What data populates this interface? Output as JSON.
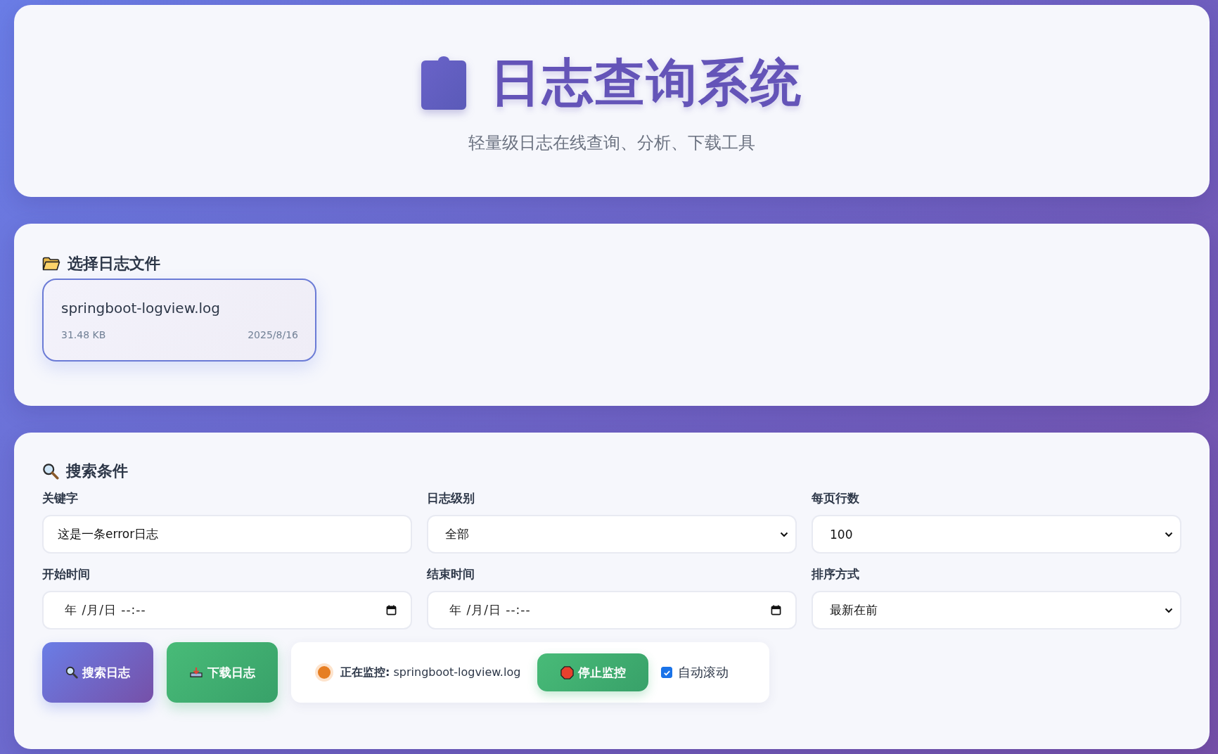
{
  "header": {
    "title": "日志查询系统",
    "subtitle": "轻量级日志在线查询、分析、下载工具"
  },
  "file_section": {
    "title": "选择日志文件",
    "files": [
      {
        "name": "springboot-logview.log",
        "size": "31.48 KB",
        "date": "2025/8/16",
        "selected": true
      }
    ]
  },
  "search": {
    "title": "搜索条件",
    "fields": [
      {
        "kind": "text",
        "label": "关键字",
        "value": "这是一条error日志"
      },
      {
        "kind": "select",
        "label": "日志级别",
        "value": "全部"
      },
      {
        "kind": "select",
        "label": "每页行数",
        "value": "100"
      },
      {
        "kind": "datetime",
        "label": "开始时间",
        "placeholder": "年 /月/日 --:--"
      },
      {
        "kind": "datetime",
        "label": "结束时间",
        "placeholder": "年 /月/日 --:--"
      },
      {
        "kind": "select",
        "label": "排序方式",
        "value": "最新在前"
      }
    ]
  },
  "actions": [
    {
      "kind": "search",
      "label": "搜索日志"
    },
    {
      "kind": "download",
      "label": "下载日志"
    }
  ],
  "monitor": {
    "active": true,
    "status": "**正在监控:** springboot-logview.log",
    "button": "停止监控",
    "auto_scroll": {
      "label": "自动滚动",
      "checked": true
    }
  }
}
